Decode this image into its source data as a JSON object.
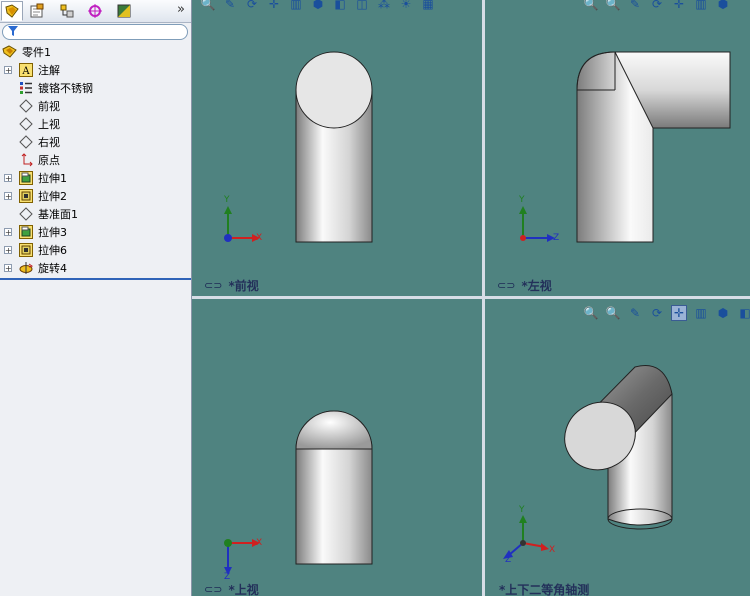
{
  "panel": {
    "tabs": [
      {
        "icon": "feature-manager-icon"
      },
      {
        "icon": "property-manager-icon"
      },
      {
        "icon": "configuration-manager-icon"
      },
      {
        "icon": "dimxpert-icon"
      },
      {
        "icon": "display-manager-icon"
      }
    ],
    "more": "»",
    "filter_icon": "funnel-icon"
  },
  "tree": {
    "root": "零件1",
    "items": [
      {
        "label": "注解",
        "icon": "annotation-icon",
        "expandable": true
      },
      {
        "label": "镀铬不锈钢",
        "icon": "material-icon",
        "expandable": false
      },
      {
        "label": "前视",
        "icon": "plane-icon",
        "expandable": false
      },
      {
        "label": "上视",
        "icon": "plane-icon",
        "expandable": false
      },
      {
        "label": "右视",
        "icon": "plane-icon",
        "expandable": false
      },
      {
        "label": "原点",
        "icon": "origin-icon",
        "expandable": false
      },
      {
        "label": "拉伸1",
        "icon": "extrude-icon",
        "expandable": true
      },
      {
        "label": "拉伸2",
        "icon": "extrude-icon",
        "expandable": true
      },
      {
        "label": "基准面1",
        "icon": "plane-icon",
        "expandable": false
      },
      {
        "label": "拉伸3",
        "icon": "extrude-icon",
        "expandable": true
      },
      {
        "label": "拉伸6",
        "icon": "extrude-icon",
        "expandable": true
      },
      {
        "label": "旋转4",
        "icon": "revolve-icon",
        "expandable": true
      }
    ]
  },
  "viewports": [
    {
      "label": "*前视",
      "axes": [
        "Y",
        "X"
      ]
    },
    {
      "label": "*左视",
      "axes": [
        "Y",
        "Z"
      ]
    },
    {
      "label": "*上视",
      "axes": [
        "X",
        "Z"
      ]
    },
    {
      "label": "*上下二等角轴测",
      "axes": [
        "Y",
        "X",
        "Z"
      ]
    }
  ],
  "colors": {
    "viewport_bg": "#4f8380",
    "part": "#c8c8c8",
    "axis_x": "#d02020",
    "axis_y": "#208020",
    "axis_z": "#2030c0"
  }
}
